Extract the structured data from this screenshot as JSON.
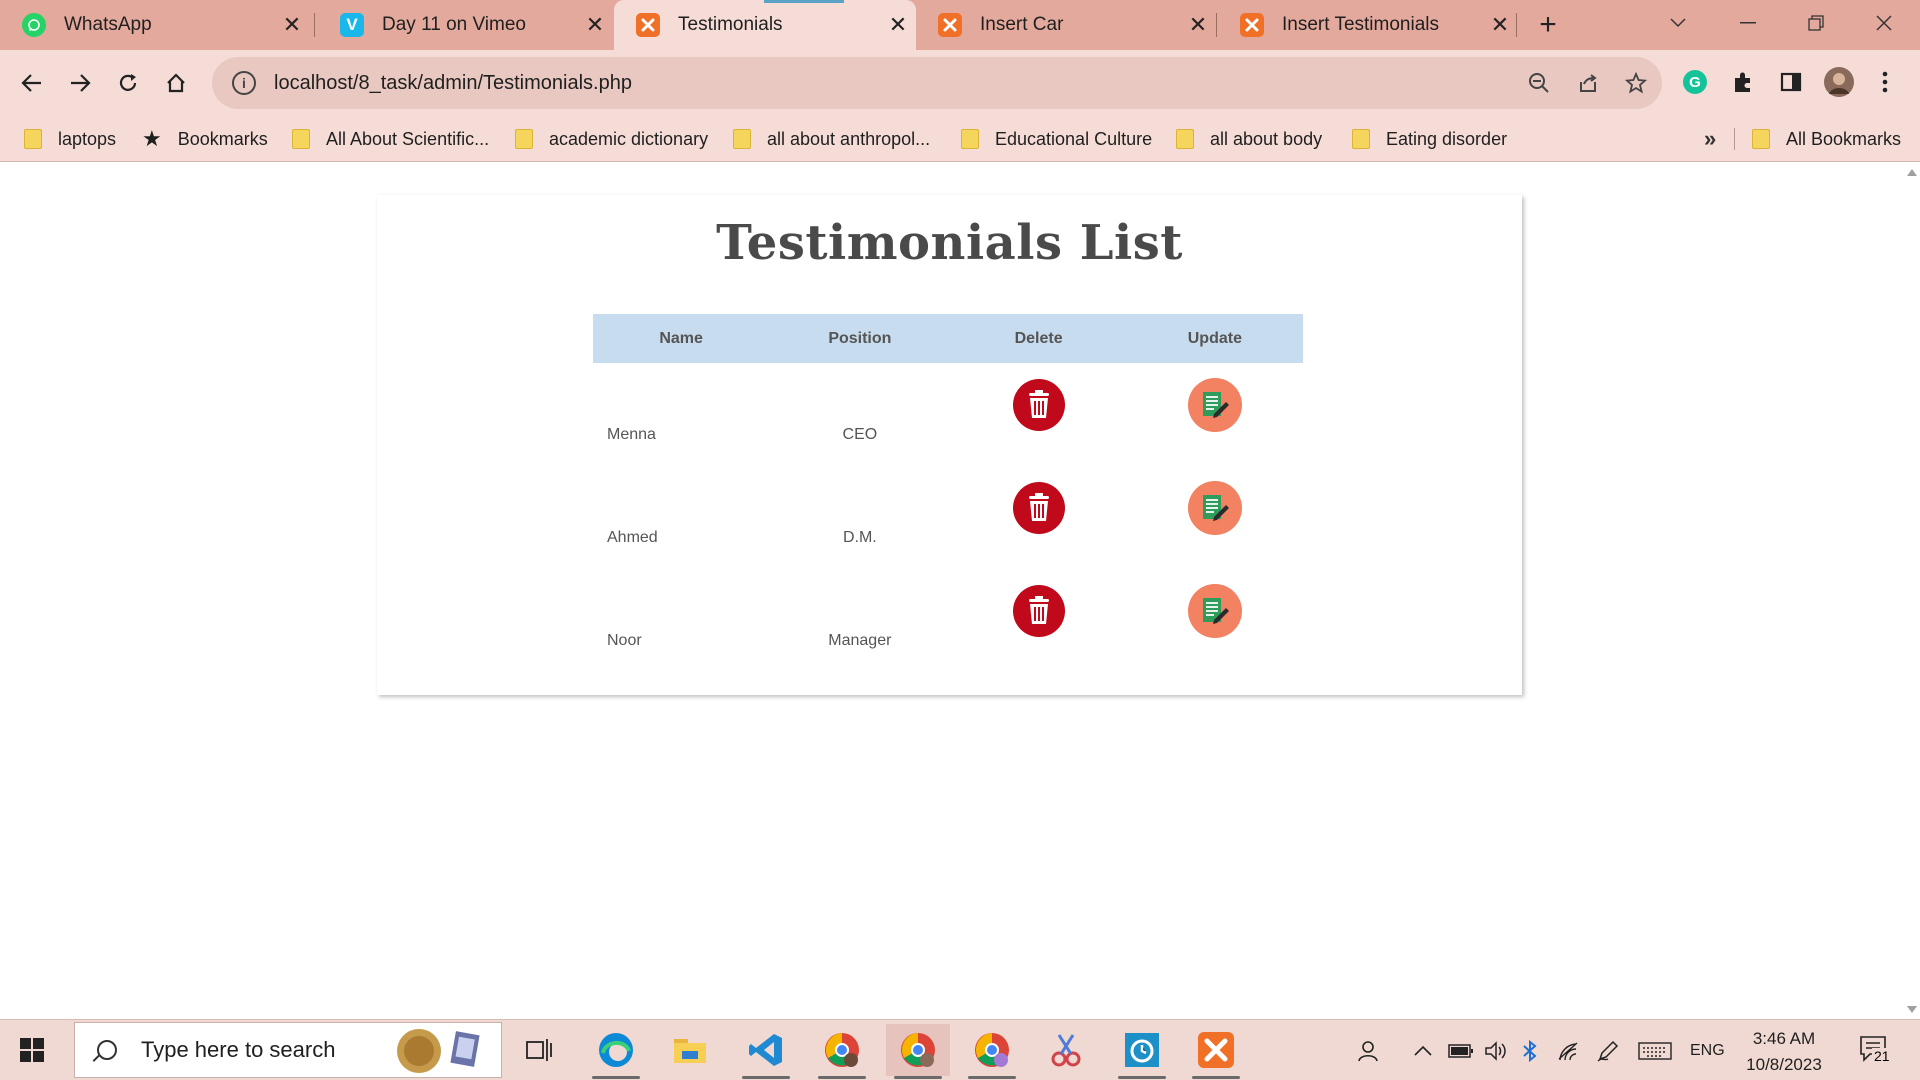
{
  "browser": {
    "tabs": [
      {
        "title": "WhatsApp",
        "icon": "whatsapp-icon"
      },
      {
        "title": "Day 11 on Vimeo",
        "icon": "vimeo-icon"
      },
      {
        "title": "Testimonials",
        "icon": "xampp-icon",
        "active": true
      },
      {
        "title": "Insert Car",
        "icon": "xampp-icon"
      },
      {
        "title": "Insert Testimonials",
        "icon": "xampp-icon"
      }
    ],
    "url": "localhost/8_task/admin/Testimonials.php",
    "bookmarks": [
      {
        "label": "laptops",
        "icon": "folder-icon"
      },
      {
        "label": "Bookmarks",
        "icon": "star-icon"
      },
      {
        "label": "All About Scientific...",
        "icon": "folder-icon"
      },
      {
        "label": "academic dictionary",
        "icon": "folder-icon"
      },
      {
        "label": "all about anthropol...",
        "icon": "folder-icon"
      },
      {
        "label": "Educational Culture",
        "icon": "folder-icon"
      },
      {
        "label": "all about body",
        "icon": "folder-icon"
      },
      {
        "label": "Eating disorder",
        "icon": "folder-icon"
      }
    ],
    "bookmarks_overflow": "»",
    "all_bookmarks": "All Bookmarks",
    "accent_colors": {
      "tabstrip": "#e4a99d",
      "toolbar": "#f6dcd6"
    }
  },
  "page": {
    "title": "Testimonials List",
    "table": {
      "headers": [
        "Name",
        "Position",
        "Delete",
        "Update"
      ],
      "rows": [
        {
          "name": "Menna",
          "position": "CEO"
        },
        {
          "name": "Ahmed",
          "position": "D.M."
        },
        {
          "name": "Noor",
          "position": "Manager"
        }
      ],
      "header_color": "#c7dcef",
      "delete_icon_color": "#c0091a",
      "update_icon_color": "#f28262"
    }
  },
  "taskbar": {
    "search_placeholder": "Type here to search",
    "language": "ENG",
    "time": "3:46 AM",
    "date": "10/8/2023",
    "notifications": "21"
  }
}
